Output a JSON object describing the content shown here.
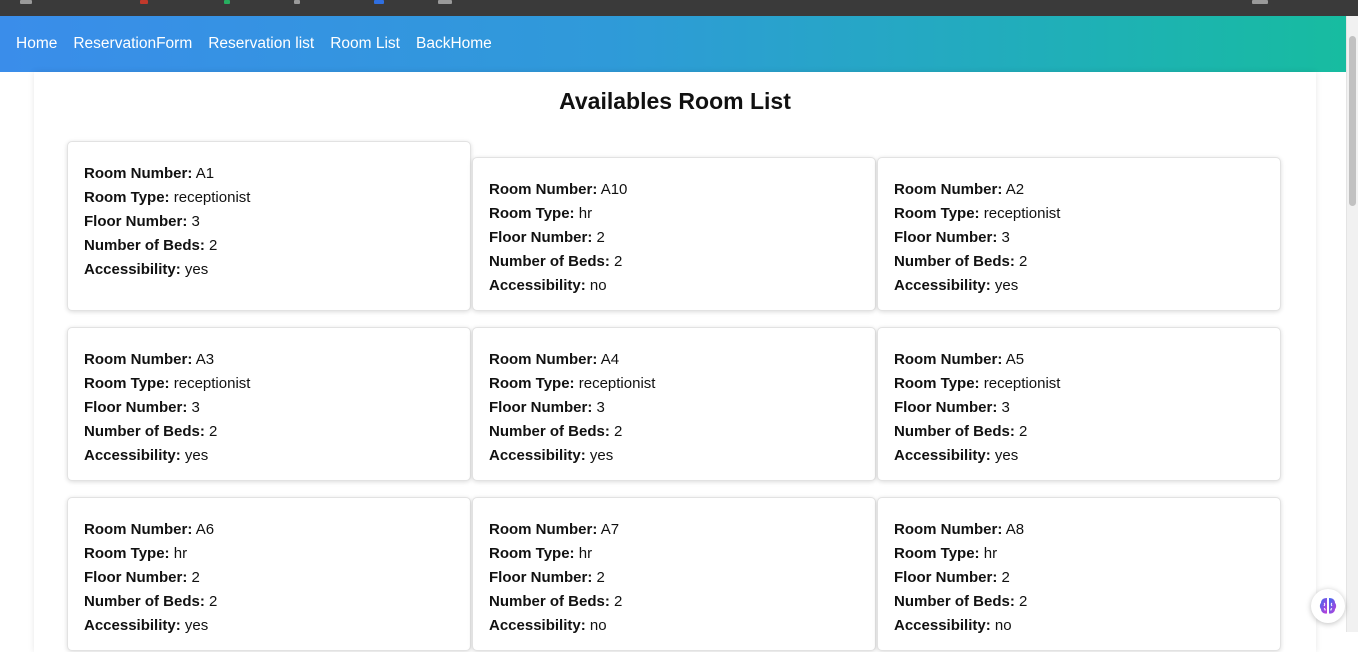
{
  "nav": {
    "links": [
      "Home",
      "ReservationForm",
      "Reservation list",
      "Room List",
      "BackHome"
    ]
  },
  "page": {
    "title": "Availables Room List"
  },
  "labels": {
    "room_number": "Room Number:",
    "room_type": "Room Type:",
    "floor_number": "Floor Number:",
    "beds": "Number of Beds:",
    "accessibility": "Accessibility:"
  },
  "rooms": [
    {
      "number": "A1",
      "type": "receptionist",
      "floor": "3",
      "beds": "2",
      "accessibility": "yes"
    },
    {
      "number": "A10",
      "type": "hr",
      "floor": "2",
      "beds": "2",
      "accessibility": "no"
    },
    {
      "number": "A2",
      "type": "receptionist",
      "floor": "3",
      "beds": "2",
      "accessibility": "yes"
    },
    {
      "number": "A3",
      "type": "receptionist",
      "floor": "3",
      "beds": "2",
      "accessibility": "yes"
    },
    {
      "number": "A4",
      "type": "receptionist",
      "floor": "3",
      "beds": "2",
      "accessibility": "yes"
    },
    {
      "number": "A5",
      "type": "receptionist",
      "floor": "3",
      "beds": "2",
      "accessibility": "yes"
    },
    {
      "number": "A6",
      "type": "hr",
      "floor": "2",
      "beds": "2",
      "accessibility": "yes"
    },
    {
      "number": "A7",
      "type": "hr",
      "floor": "2",
      "beds": "2",
      "accessibility": "no"
    },
    {
      "number": "A8",
      "type": "hr",
      "floor": "2",
      "beds": "2",
      "accessibility": "no"
    }
  ],
  "colors": {
    "nav_gradient_start": "#3a8dea",
    "nav_gradient_end": "#17bca0",
    "nav_text": "#ffffff"
  },
  "icons": {
    "fab": "brain-icon"
  }
}
